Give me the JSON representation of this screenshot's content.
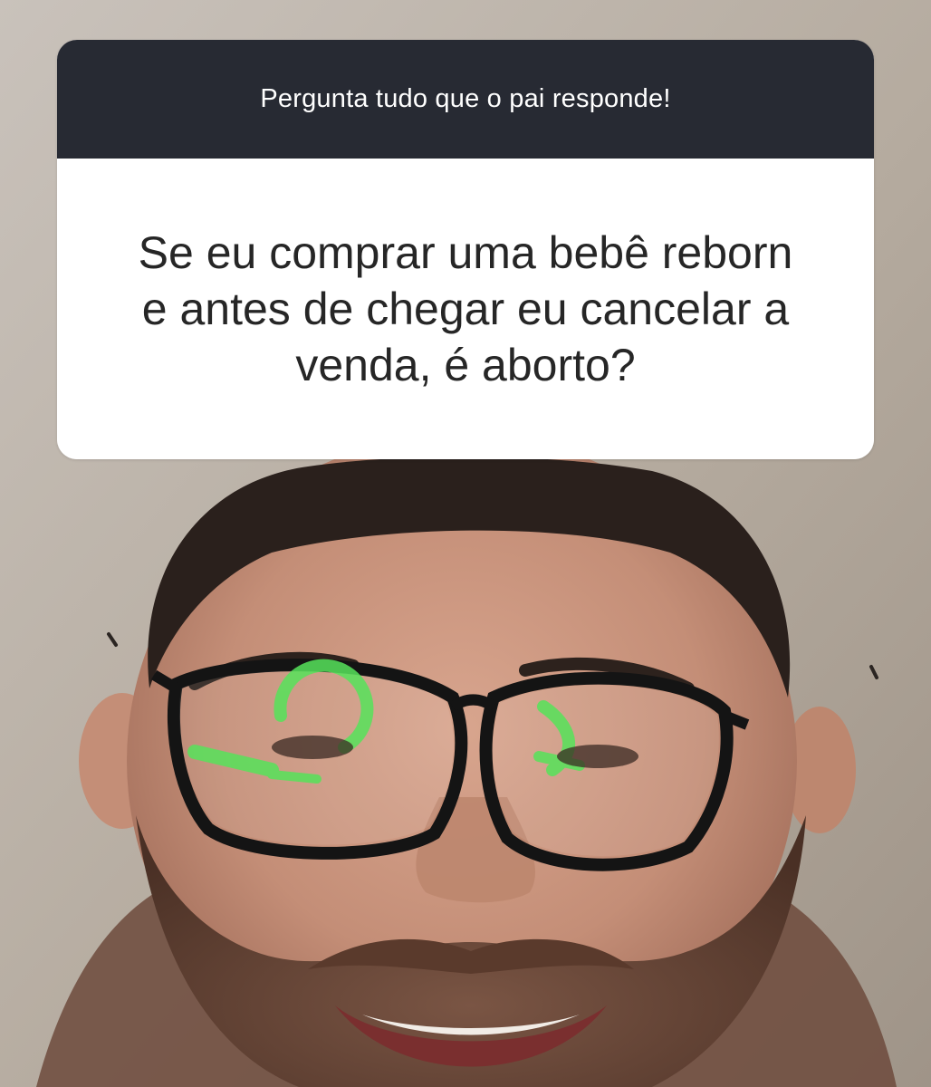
{
  "sticker": {
    "prompt": "Pergunta tudo que o pai responde!",
    "question": "Se eu comprar uma bebê reborn\ne antes de chegar eu cancelar a\nvenda, é aborto?"
  },
  "colors": {
    "sticker_header_bg": "#272a33",
    "sticker_body_bg": "#ffffff",
    "question_text": "#262626",
    "wall_background": "#b8afa6",
    "screen_reflection": "#56e35a"
  }
}
